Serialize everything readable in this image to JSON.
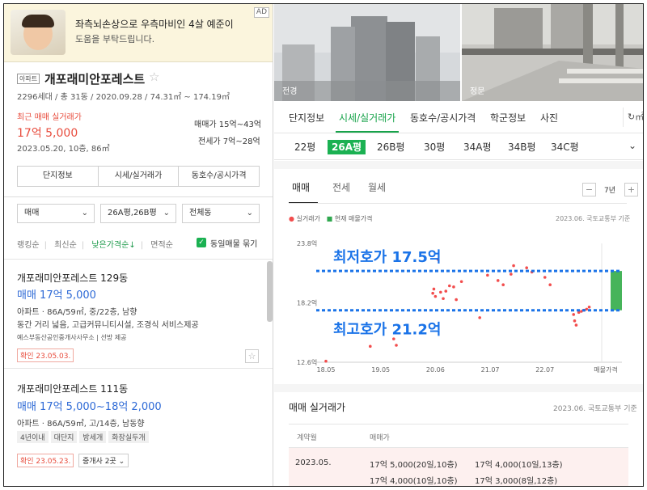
{
  "ad": {
    "title": "좌측뇌손상으로 우측마비인 4살 예준이",
    "subtitle": "도움을 부탁드립니다.",
    "badge": "AD"
  },
  "complex": {
    "type_tag": "아파트",
    "name": "개포래미안포레스트",
    "meta": "2296세대 / 총 31동 / 2020.09.28 / 74.31㎡ ~ 174.19㎡",
    "recent_label": "최근 매매 실거래가",
    "recent_price": "17억 5,000",
    "recent_date": "2023.05.20, 10층, 86㎡",
    "sale_range": "매매가 15억~43억",
    "jeonse_range": "전세가 7억~28억",
    "tabs": [
      "단지정보",
      "시세/실거래가",
      "동호수/공시가격"
    ]
  },
  "filters": {
    "deal_type": "매매",
    "area": "26A평,26B평",
    "building": "전체동"
  },
  "sorts": [
    "랭킹순",
    "최신순",
    "낮은가격순↓",
    "면적순"
  ],
  "same_listing_label": "동일매물 묶기",
  "listings": [
    {
      "title": "개포래미안포레스트 129동",
      "price": "매매 17억 5,000",
      "desc1": "아파트 · 86A/59㎡, 중/22층, 남향",
      "desc2": "동간 거리 넓음, 고급커뮤니티시설, 조경식 서비스제공",
      "agent": "예스부동산공인중개사사무소 | 선방 제공",
      "confirm": "확인 23.05.03."
    },
    {
      "title": "개포래미안포레스트 111동",
      "price": "매매 17억 5,000~18억 2,000",
      "desc1": "아파트 · 86A/59㎡, 고/14층, 남동향",
      "chips": [
        "4년이내",
        "대단지",
        "방세개",
        "화장실두개"
      ],
      "confirm": "확인 23.05.23.",
      "broker": "중개사 2곳"
    }
  ],
  "photos": [
    {
      "label": "전경"
    },
    {
      "label": "정문"
    }
  ],
  "detail_tabs": [
    "단지정보",
    "시세/실거래가",
    "동호수/공시가격",
    "학군정보",
    "사진"
  ],
  "detail_icon_label": "㎡",
  "pyeong_tabs": [
    "22평",
    "26A평",
    "26B평",
    "30평",
    "34A평",
    "34B평",
    "34C평"
  ],
  "trade_tabs": [
    "매매",
    "전세",
    "월세"
  ],
  "period": "7년",
  "legend": {
    "actual": "실거래가",
    "current": "현재 매물가격"
  },
  "source": "2023.06. 국토교통부 기준",
  "chart_data": {
    "type": "scatter",
    "y_ticks": [
      "23.8억",
      "18.2억",
      "12.6억"
    ],
    "ylim": [
      12.6,
      23.8
    ],
    "x_ticks": [
      "18.05",
      "19.05",
      "20.06",
      "21.07",
      "22.07",
      "매물가격"
    ],
    "series": [
      {
        "name": "실거래가",
        "color": "#f24d4d",
        "points": [
          [
            2018.35,
            12.7
          ],
          [
            2019.2,
            14.1
          ],
          [
            2019.65,
            14.8
          ],
          [
            2019.7,
            14.2
          ],
          [
            2020.4,
            19.1
          ],
          [
            2020.42,
            19.5
          ],
          [
            2020.45,
            18.8
          ],
          [
            2020.5,
            22.3
          ],
          [
            2020.55,
            19.2
          ],
          [
            2020.6,
            18.6
          ],
          [
            2020.65,
            19.3
          ],
          [
            2020.72,
            19.8
          ],
          [
            2020.8,
            19.7
          ],
          [
            2020.85,
            18.5
          ],
          [
            2020.95,
            20.2
          ],
          [
            2021.3,
            16.8
          ],
          [
            2021.45,
            20.8
          ],
          [
            2021.65,
            20.3
          ],
          [
            2021.75,
            19.9
          ],
          [
            2021.9,
            20.9
          ],
          [
            2021.95,
            21.7
          ],
          [
            2022.2,
            21.5
          ],
          [
            2022.3,
            21.1
          ],
          [
            2022.55,
            20.6
          ],
          [
            2022.65,
            19.9
          ],
          [
            2023.1,
            17.1
          ],
          [
            2023.12,
            16.5
          ],
          [
            2023.15,
            16.1
          ],
          [
            2023.2,
            17.3
          ],
          [
            2023.25,
            17.4
          ],
          [
            2023.3,
            17.5
          ],
          [
            2023.35,
            17.6
          ],
          [
            2023.4,
            17.8
          ]
        ]
      }
    ],
    "current_listing_range": [
      17.5,
      21.2
    ],
    "annotations": [
      "최저호가 17.5억",
      "최고호가 21.2억"
    ]
  },
  "transactions": {
    "title": "매매 실거래가",
    "source": "2023.06. 국토교통부 기준",
    "headers": [
      "계약월",
      "매매가"
    ],
    "rows": [
      {
        "month": "2023.05.",
        "entries": [
          "17억 5,000(20일,10층)",
          "17억 4,000(10일,13층)",
          "17억 4,000(10일,10층)",
          "17억 3,000(8일,12층)"
        ]
      }
    ]
  }
}
